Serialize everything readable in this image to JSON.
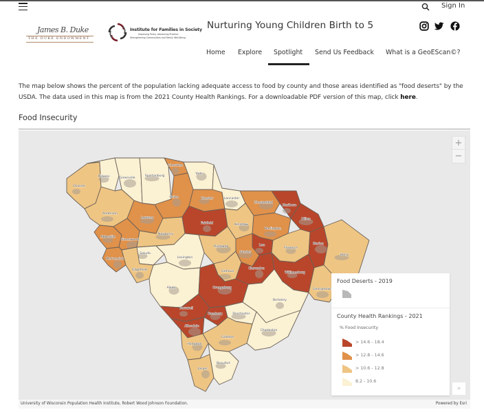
{
  "header": {
    "menu_icon": "hamburger-menu-icon",
    "search_icon": "search-icon",
    "sign_in": "Sign In",
    "site_title": "Nurturing Young Children Birth to 5",
    "social": [
      "instagram-icon",
      "twitter-icon",
      "facebook-icon"
    ]
  },
  "logos": {
    "duke": {
      "signature": "James B. Duke",
      "name": "THE DUKE ENDOWMENT"
    },
    "ifs": {
      "title": "Institute for Families in Society",
      "tagline_1": "Improving Policy. Advancing Practice.",
      "tagline_2": "Strengthening Communities and Family Well-Being"
    }
  },
  "nav": {
    "items": [
      {
        "label": "Home",
        "active": false
      },
      {
        "label": "Explore",
        "active": false
      },
      {
        "label": "Spotlight",
        "active": true
      },
      {
        "label": "Send Us Feedback",
        "active": false
      },
      {
        "label": "What is a GeoEScan©?",
        "active": false
      }
    ]
  },
  "intro": {
    "text_before_link": "The map below shows the percent of the population lacking adequate access to food by county and those areas identified as \"food deserts\" by the USDA. The data used in this map is from the 2021 County Health Rankings. For a downloadable PDF version of this map, click ",
    "link_text": "here",
    "text_after_link": "."
  },
  "section": {
    "title": "Food Insecurity"
  },
  "map": {
    "zoom_in": "+",
    "zoom_out": "−",
    "expand": "»",
    "attribution_left": "University of Wisconsin Population Health Institute, Robert Wood Johnson Foundation.",
    "attribution_right": "Powered by Esri",
    "colors": {
      "class_1": "#b9462b",
      "class_2": "#e0914a",
      "class_3": "#efc583",
      "class_4": "#fbf1d3",
      "food_desert": "#a89c91",
      "background": "#e9e9ea",
      "border": "#6a6057"
    },
    "legend": {
      "food_deserts_title": "Food Deserts - 2019",
      "rankings_title": "County Health Rankings - 2021",
      "measure": "% Food Insecurity",
      "classes": [
        {
          "label": "> 14.6 - 18.4",
          "color": "#b9462b"
        },
        {
          "label": "> 12.8 - 14.6",
          "color": "#e0914a"
        },
        {
          "label": "> 10.6 - 12.8",
          "color": "#efc583"
        },
        {
          "label": "8.2 - 10.6",
          "color": "#fbf1d3"
        }
      ]
    },
    "counties": [
      {
        "name": "Oconee",
        "class": 3
      },
      {
        "name": "Pickens",
        "class": 4
      },
      {
        "name": "Greenville",
        "class": 4
      },
      {
        "name": "Spartanburg",
        "class": 4
      },
      {
        "name": "Cherokee",
        "class": 2
      },
      {
        "name": "York",
        "class": 4
      },
      {
        "name": "Anderson",
        "class": 3
      },
      {
        "name": "Laurens",
        "class": 2
      },
      {
        "name": "Union",
        "class": 2
      },
      {
        "name": "Chester",
        "class": 2
      },
      {
        "name": "Lancaster",
        "class": 4
      },
      {
        "name": "Chesterfield",
        "class": 2
      },
      {
        "name": "Marlboro",
        "class": 1
      },
      {
        "name": "Abbeville",
        "class": 2
      },
      {
        "name": "Greenwood",
        "class": 2
      },
      {
        "name": "Newberry",
        "class": 3
      },
      {
        "name": "Fairfield",
        "class": 1
      },
      {
        "name": "Kershaw",
        "class": 3
      },
      {
        "name": "Darlington",
        "class": 2
      },
      {
        "name": "Dillon",
        "class": 1
      },
      {
        "name": "McCormick",
        "class": 2
      },
      {
        "name": "Saluda",
        "class": 4
      },
      {
        "name": "Lexington",
        "class": 4
      },
      {
        "name": "Richland",
        "class": 3
      },
      {
        "name": "Lee",
        "class": 1
      },
      {
        "name": "Florence",
        "class": 3
      },
      {
        "name": "Marion",
        "class": 1
      },
      {
        "name": "Horry",
        "class": 3
      },
      {
        "name": "Edgefield",
        "class": 3
      },
      {
        "name": "Aiken",
        "class": 4
      },
      {
        "name": "Calhoun",
        "class": 3
      },
      {
        "name": "Sumter",
        "class": 2
      },
      {
        "name": "Clarendon",
        "class": 1
      },
      {
        "name": "Williamsburg",
        "class": 1
      },
      {
        "name": "Georgetown",
        "class": 3
      },
      {
        "name": "Orangeburg",
        "class": 1
      },
      {
        "name": "Barnwell",
        "class": 1
      },
      {
        "name": "Bamberg",
        "class": 1
      },
      {
        "name": "Allendale",
        "class": 1
      },
      {
        "name": "Dorchester",
        "class": 4
      },
      {
        "name": "Berkeley",
        "class": 4
      },
      {
        "name": "Hampton",
        "class": 3
      },
      {
        "name": "Colleton",
        "class": 3
      },
      {
        "name": "Charleston",
        "class": 4
      },
      {
        "name": "Jasper",
        "class": 3
      },
      {
        "name": "Beaufort",
        "class": 4
      }
    ]
  }
}
